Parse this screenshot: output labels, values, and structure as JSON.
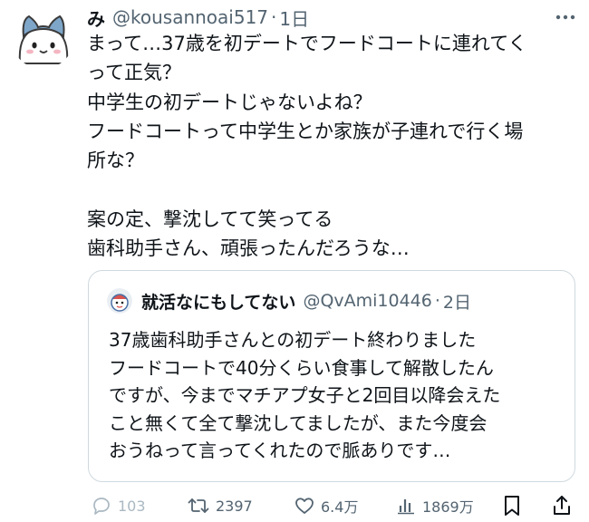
{
  "tweet": {
    "author_name": "み",
    "author_handle": "@kousannoai517",
    "separator": "·",
    "time": "1日",
    "lines": [
      "まって…37歳を初デートでフードコートに連れてく",
      "って正気？",
      "中学生の初デートじゃないよね？",
      "フードコートって中学生とか家族が子連れで行く場",
      "所な？",
      "",
      "案の定、撃沈してて笑ってる",
      "歯科助手さん、頑張ったんだろうな…"
    ]
  },
  "quote": {
    "author_name": "就活なにもしてない",
    "author_handle": "@QvAmi10446",
    "separator": "·",
    "time": "2日",
    "lines": [
      "37歳歯科助手さんとの初デート終わりました",
      "フードコートで40分くらい食事して解散したん",
      "ですが、今までマチアプ女子と2回目以降会えた",
      "こと無くて全て撃沈してましたが、また今度会",
      "おうねって言ってくれたので脈ありです…"
    ]
  },
  "actions": {
    "replies": "103",
    "retweets": "2397",
    "likes": "6.4万",
    "views": "1869万"
  },
  "icons": {
    "more": "more-icon",
    "reply": "reply-icon",
    "retweet": "retweet-icon",
    "like": "heart-icon",
    "views": "views-icon",
    "bookmark": "bookmark-icon",
    "share": "share-icon"
  },
  "colors": {
    "text": "#0f1419",
    "secondary": "#536471",
    "border": "#cfd9de",
    "avatar_accent": "#7ea6c9"
  }
}
